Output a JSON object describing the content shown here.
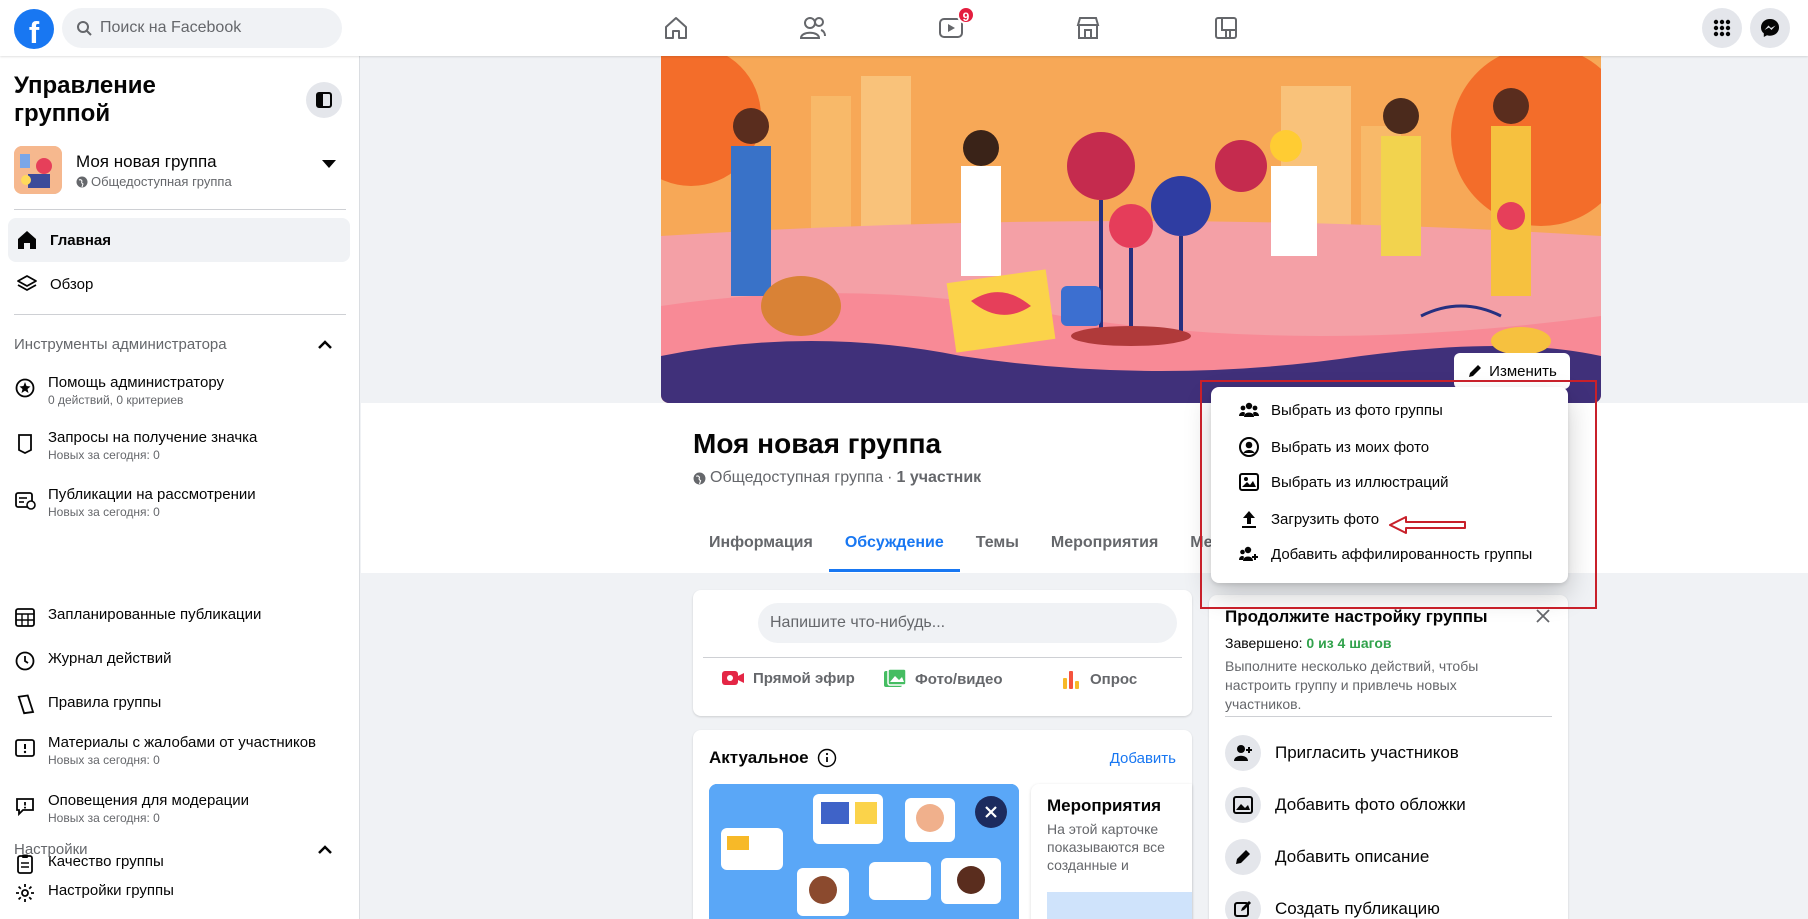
{
  "topbar": {
    "search_placeholder": "Поиск на Facebook",
    "video_badge": "9",
    "logo_letter": "f"
  },
  "sidebar": {
    "title": "Управление группой",
    "group_name": "Моя новая группа",
    "group_privacy": "Общедоступная группа",
    "nav": [
      {
        "label": "Главная"
      },
      {
        "label": "Обзор"
      }
    ],
    "admin_tools_title": "Инструменты администратора",
    "tools": [
      {
        "label": "Помощь администратору",
        "sub": "0 действий, 0 критериев"
      },
      {
        "label": "Запросы на получение значка",
        "sub": "Новых за сегодня: 0"
      },
      {
        "label": "Публикации на рассмотрении",
        "sub": "Новых за сегодня: 0"
      },
      {
        "label": "Запланированные публикации",
        "sub": ""
      },
      {
        "label": "Журнал действий",
        "sub": ""
      },
      {
        "label": "Правила группы",
        "sub": ""
      },
      {
        "label": "Материалы с жалобами от участников",
        "sub": "Новых за сегодня: 0"
      },
      {
        "label": "Оповещения для модерации",
        "sub": "Новых за сегодня: 0"
      },
      {
        "label": "Качество группы",
        "sub": ""
      }
    ],
    "settings_title": "Настройки",
    "settings_items": [
      {
        "label": "Настройки группы"
      }
    ]
  },
  "cover": {
    "edit_label": "Изменить"
  },
  "group": {
    "name": "Моя новая группа",
    "privacy": "Общедоступная группа",
    "separator": "·",
    "members": "1 участник"
  },
  "tabs": [
    {
      "label": "Информация"
    },
    {
      "label": "Обсуждение"
    },
    {
      "label": "Темы"
    },
    {
      "label": "Мероприятия"
    },
    {
      "label": "Медиафайлы"
    }
  ],
  "composer": {
    "placeholder": "Напишите что-нибудь...",
    "live": "Прямой эфир",
    "photo": "Фото/видео",
    "poll": "Опрос"
  },
  "featured": {
    "title": "Актуальное",
    "add": "Добавить",
    "events_title": "Мероприятия",
    "events_text": "На этой карточке показываются все созданные и опубликованные мероприятия."
  },
  "popup": {
    "items": [
      {
        "label": "Выбрать из фото группы"
      },
      {
        "label": "Выбрать из моих фото"
      },
      {
        "label": "Выбрать из иллюстраций"
      },
      {
        "label": "Загрузить фото"
      },
      {
        "label": "Добавить аффилированность группы"
      }
    ]
  },
  "setup": {
    "title": "Продолжите настройку группы",
    "done_label": "Завершено:",
    "done_value": "0 из 4 шагов",
    "desc": "Выполните несколько действий, чтобы настроить группу и привлечь новых участников.",
    "items": [
      {
        "label": "Пригласить участников"
      },
      {
        "label": "Добавить фото обложки"
      },
      {
        "label": "Добавить описание"
      },
      {
        "label": "Создать публикацию"
      }
    ]
  },
  "colors": {
    "brand": "#1877f2",
    "annotation": "#c8202a",
    "progress": "#31a24c"
  }
}
